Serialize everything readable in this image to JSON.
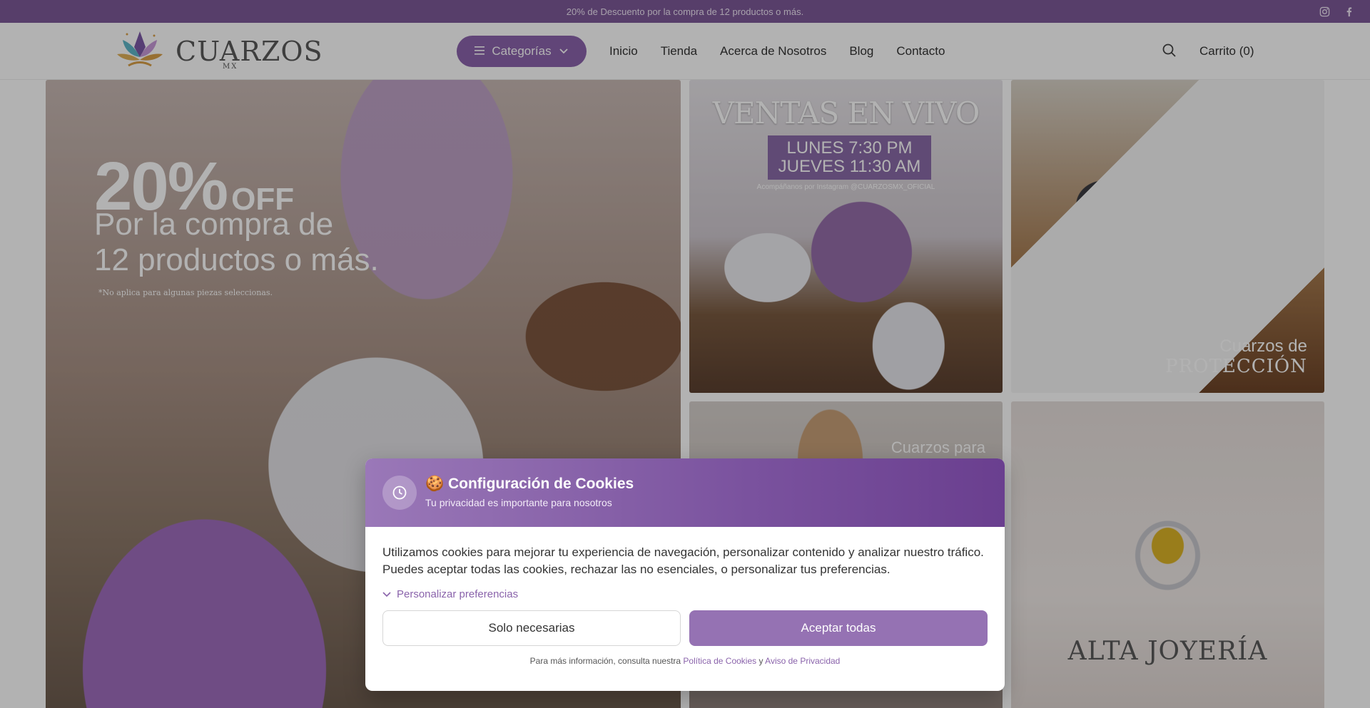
{
  "topbar": {
    "promo_text": "20% de Descuento por la compra de 12 productos o más.",
    "social_icons": [
      "instagram-icon",
      "facebook-icon"
    ]
  },
  "header": {
    "logo_text": "CUARZOS",
    "logo_sub": "MX",
    "categories_label": "Categorías",
    "nav": [
      "Inicio",
      "Tienda",
      "Acerca de Nosotros",
      "Blog",
      "Contacto"
    ],
    "cart_label": "Carrito (0)"
  },
  "banners": {
    "main": {
      "big": "20%",
      "off": "OFF",
      "line1": "Por la compra de",
      "line2": "12 productos o más.",
      "fine": "*No aplica para algunas piezas seleccionas."
    },
    "ventas": {
      "title": "VENTAS EN VIVO",
      "line1": "LUNES  7:30 PM",
      "line2": "JUEVES  11:30 AM",
      "ig": "Acompáñanos por Instagram @CUARZOSMX_OFICIAL"
    },
    "proteccion": {
      "line1": "Cuarzos de",
      "line2": "PROTECCIÓN"
    },
    "buda": {
      "text": "Cuarzos para"
    },
    "joyeria": {
      "text": "ALTA JOYERÍA"
    }
  },
  "cookie": {
    "title": "🍪 Configuración de Cookies",
    "subtitle": "Tu privacidad es importante para nosotros",
    "description": "Utilizamos cookies para mejorar tu experiencia de navegación, personalizar contenido y analizar nuestro tráfico. Puedes aceptar todas las cookies, rechazar las no esenciales, o personalizar tus preferencias.",
    "customize_label": "Personalizar preferencias",
    "reject_label": "Solo necesarias",
    "accept_label": "Aceptar todas",
    "footer_prefix": "Para más información, consulta nuestra ",
    "policy_link": "Política de Cookies",
    "footer_and": " y ",
    "privacy_link": "Aviso de Privacidad"
  },
  "colors": {
    "brand_purple": "#7d5a99",
    "button_purple": "#8c64ad",
    "accept_purple": "#9572b3"
  }
}
